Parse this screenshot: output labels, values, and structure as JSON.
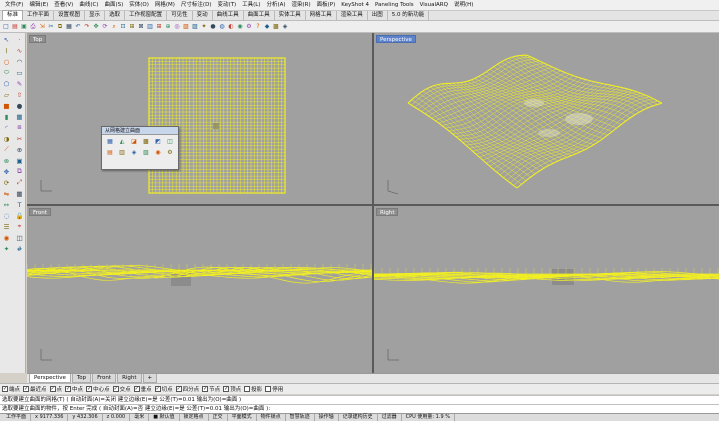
{
  "menu": [
    "文件(F)",
    "编辑(E)",
    "查看(V)",
    "曲线(C)",
    "曲面(S)",
    "实体(O)",
    "网格(M)",
    "尺寸标注(D)",
    "变动(T)",
    "工具(L)",
    "分析(A)",
    "渲染(R)",
    "面板(P)",
    "KeyShot 4",
    "Paneling Tools",
    "VisualARQ",
    "说明(H)"
  ],
  "tabs": [
    "标准",
    "工作平面",
    "设置视图",
    "显示",
    "选取",
    "工作视窗配置",
    "可见性",
    "变动",
    "曲线工具",
    "曲面工具",
    "实体工具",
    "网格工具",
    "渲染工具",
    "出图",
    "5.0 的新功能"
  ],
  "active_tab": "标准",
  "toolbar_icons": [
    "new-icon",
    "open-icon",
    "save-icon",
    "print-icon",
    "import-icon",
    "cut-icon",
    "copy-icon",
    "paste-icon",
    "undo-icon",
    "redo-icon",
    "pan-icon",
    "rotate-icon",
    "zoom-icon",
    "zoom-window-icon",
    "zoom-extents-icon",
    "zoom-selected-icon",
    "viewport-layout-icon",
    "four-view-icon",
    "construction-plane-icon",
    "osnap-icon",
    "layer-icon",
    "properties-icon",
    "light-icon",
    "render-icon",
    "material-icon",
    "render-preview-icon",
    "sphere-icon",
    "options-icon",
    "help-icon",
    "keyshot-icon",
    "paneling-icon",
    "visualarq-icon"
  ],
  "viewports": {
    "top": "Top",
    "perspective": "Perspective",
    "front": "Front",
    "right": "Right"
  },
  "float_panel": {
    "title": "从网格建立曲面"
  },
  "viewport_tabs": [
    "Perspective",
    "Top",
    "Front",
    "Right",
    "+"
  ],
  "osnap": [
    {
      "label": "端点",
      "checked": true
    },
    {
      "label": "最近点",
      "checked": true
    },
    {
      "label": "点",
      "checked": true
    },
    {
      "label": "中点",
      "checked": true
    },
    {
      "label": "中心点",
      "checked": true
    },
    {
      "label": "交点",
      "checked": true
    },
    {
      "label": "垂点",
      "checked": true
    },
    {
      "label": "切点",
      "checked": true
    },
    {
      "label": "四分点",
      "checked": true
    },
    {
      "label": "节点",
      "checked": true
    },
    {
      "label": "顶点",
      "checked": true
    },
    {
      "label": "投影",
      "checked": false
    },
    {
      "label": "停用",
      "checked": false
    }
  ],
  "command": {
    "line1": "选取要建立曲面的网格(T)   ( 自动封面(A)=关闭   建立边缘(E)=是   公差(T)=0.01   输出为(O)=曲面 )",
    "line2": "选取要建立曲面的物件，按 Enter 完成  ( 自动封面(A)=否  建立边缘(E)=是  公差(T)=0.01  输出为(O)=曲面 ):"
  },
  "status": [
    "工作平面",
    "x 9177.336",
    "y 432.306",
    "z 0.000",
    "毫米",
    "■ 默认值",
    "锁定格点",
    "正交",
    "平面模式",
    "物件锁点",
    "智慧轨迹",
    "操作轴",
    "记录建构历史",
    "过滤器",
    "CPU 使用量: 1.9 %"
  ],
  "colors": {
    "viewport_bg": "#a0a0a0",
    "mesh": "#f2ef22",
    "active_title": "#5d82c9"
  }
}
